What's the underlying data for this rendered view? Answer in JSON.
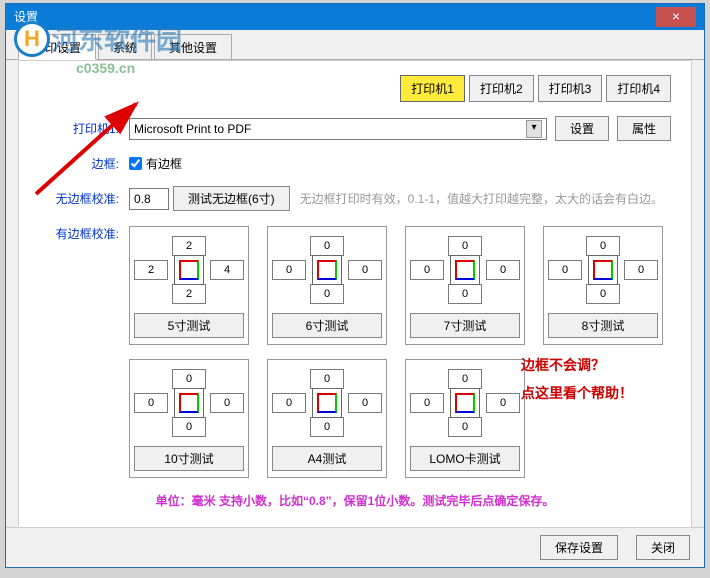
{
  "window": {
    "title": "设置",
    "close": "×"
  },
  "watermark": {
    "logo": "H",
    "text": "河东软件园",
    "url": "c0359.cn"
  },
  "tabs": [
    {
      "label": "打印设置",
      "active": true
    },
    {
      "label": "系统",
      "active": false
    },
    {
      "label": "其他设置",
      "active": false
    }
  ],
  "printerTabs": [
    {
      "label": "打印机1",
      "active": true
    },
    {
      "label": "打印机2",
      "active": false
    },
    {
      "label": "打印机3",
      "active": false
    },
    {
      "label": "打印机4",
      "active": false
    }
  ],
  "printerRow": {
    "label": "打印机1:",
    "value": "Microsoft Print to PDF",
    "settingsBtn": "设置",
    "propsBtn": "属性"
  },
  "borderRow": {
    "label": "边框:",
    "checkboxLabel": "有边框",
    "checked": true
  },
  "noBorderCalib": {
    "label": "无边框校准:",
    "value": "0.8",
    "testBtn": "测试无边框(6寸)",
    "hint": "无边框打印时有效，0.1-1，值越大打印越完整，太大的话会有白边。"
  },
  "borderCalib": {
    "label": "有边框校准:"
  },
  "calibBoxes": [
    {
      "top": "2",
      "left": "2",
      "right": "4",
      "bottom": "2",
      "btn": "5寸测试"
    },
    {
      "top": "0",
      "left": "0",
      "right": "0",
      "bottom": "0",
      "btn": "6寸测试"
    },
    {
      "top": "0",
      "left": "0",
      "right": "0",
      "bottom": "0",
      "btn": "7寸测试"
    },
    {
      "top": "0",
      "left": "0",
      "right": "0",
      "bottom": "0",
      "btn": "8寸测试"
    },
    {
      "top": "0",
      "left": "0",
      "right": "0",
      "bottom": "0",
      "btn": "10寸测试"
    },
    {
      "top": "0",
      "left": "0",
      "right": "0",
      "bottom": "0",
      "btn": "A4测试"
    },
    {
      "top": "0",
      "left": "0",
      "right": "0",
      "bottom": "0",
      "btn": "LOMO卡测试"
    }
  ],
  "helpBox": {
    "line1": "边框不会调？",
    "line2": "点这里看个帮助！"
  },
  "footerNote": "单位：毫米  支持小数，比如“0.8”，保留1位小数。测试完毕后点确定保存。",
  "bottomBar": {
    "saveBtn": "保存设置",
    "closeBtn": "关闭"
  }
}
